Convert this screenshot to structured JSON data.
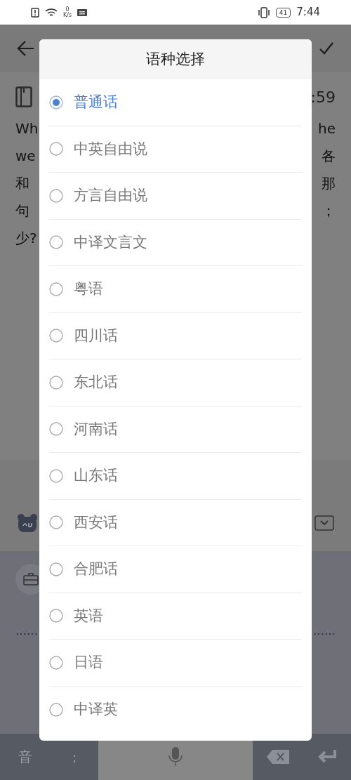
{
  "status_bar": {
    "net_speed_value": "0",
    "net_speed_unit": "K/s",
    "battery": "41",
    "time": "7:44"
  },
  "note": {
    "time": ":59",
    "lines": [
      {
        "left": "Wh",
        "right": "he"
      },
      {
        "left": "we",
        "right": "各"
      },
      {
        "left": "和",
        "right": "那"
      },
      {
        "left": "句",
        "right": "；"
      },
      {
        "left": "少?"
      }
    ]
  },
  "keyboard": {
    "left_key": "音",
    "punct_key": "；",
    "dots_left": "……",
    "dots_right": "……"
  },
  "dialog": {
    "title": "语种选择",
    "options": [
      {
        "label": "普通话",
        "selected": true
      },
      {
        "label": "中英自由说",
        "selected": false
      },
      {
        "label": "方言自由说",
        "selected": false
      },
      {
        "label": "中译文言文",
        "selected": false
      },
      {
        "label": "粤语",
        "selected": false
      },
      {
        "label": "四川话",
        "selected": false
      },
      {
        "label": "东北话",
        "selected": false
      },
      {
        "label": "河南话",
        "selected": false
      },
      {
        "label": "山东话",
        "selected": false
      },
      {
        "label": "西安话",
        "selected": false
      },
      {
        "label": "合肥话",
        "selected": false
      },
      {
        "label": "英语",
        "selected": false
      },
      {
        "label": "日语",
        "selected": false
      },
      {
        "label": "中译英",
        "selected": false
      }
    ]
  }
}
